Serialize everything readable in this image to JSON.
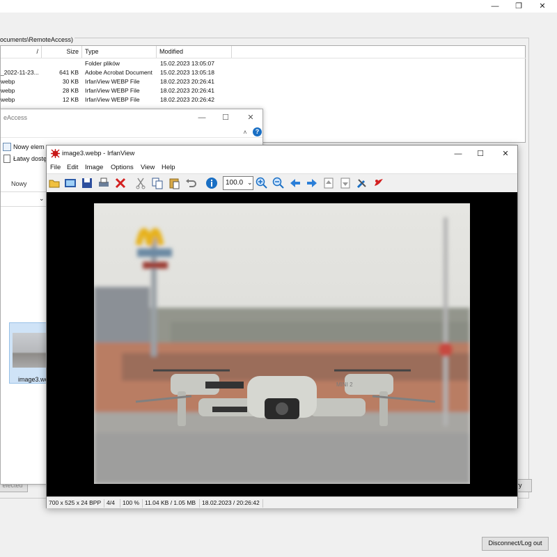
{
  "remote_window": {
    "path_label": "ocuments\\RemoteAccess)",
    "columns": [
      "/",
      "Size",
      "Type",
      "Modified"
    ],
    "rows": [
      {
        "name": "",
        "size": "",
        "type": "Folder plików",
        "modified": "15.02.2023 13:05:07"
      },
      {
        "name": "_2022-11-23...",
        "size": "641 KB",
        "type": "Adobe Acrobat Document",
        "modified": "15.02.2023 13:05:18"
      },
      {
        "name": "webp",
        "size": "30 KB",
        "type": "IrfanView WEBP File",
        "modified": "18.02.2023 20:26:41"
      },
      {
        "name": "webp",
        "size": "28 KB",
        "type": "IrfanView WEBP File",
        "modified": "18.02.2023 20:26:41"
      },
      {
        "name": "webp",
        "size": "12 KB",
        "type": "IrfanView WEBP File",
        "modified": "18.02.2023 20:26:42"
      }
    ],
    "selected_button": "elected",
    "history_button": "ry",
    "disconnect_button": "Disconnect/Log out"
  },
  "explorer": {
    "title": "eAccess",
    "ribbon_new_item": "Nowy elem",
    "ribbon_easy_access": "Łatwy dostę",
    "ribbon_group": "Nowy",
    "thumbnail_label": "image3.we"
  },
  "irfanview": {
    "title": "image3.webp - IrfanView",
    "menu": [
      "File",
      "Edit",
      "Image",
      "Options",
      "View",
      "Help"
    ],
    "zoom_value": "100.0",
    "status": {
      "dimensions": "700 x 525 x 24 BPP",
      "index": "4/4",
      "zoom": "100 %",
      "size": "11.04 KB / 1.05 MB",
      "date": "18.02.2023 / 20:26:42"
    },
    "photo_text": "MINI 2"
  },
  "colors": {
    "accent_blue": "#1a6fc4",
    "red": "#d32020",
    "canvas": "#000000"
  }
}
